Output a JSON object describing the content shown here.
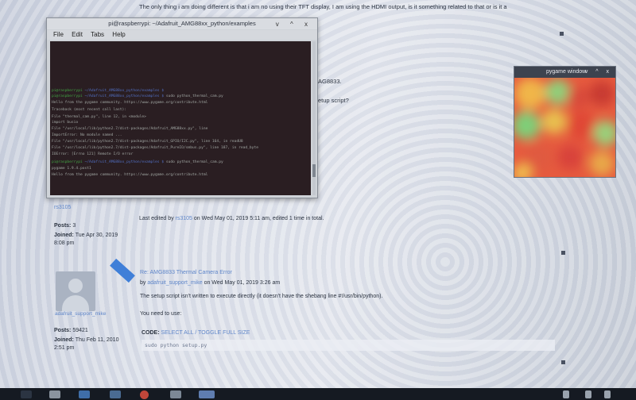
{
  "post_top_text": "The only thing i am doing different is that i am no using their TFT display, I am using the HDMI output, is it something related to that or is it a",
  "terminal": {
    "title": "pi@raspberrypi: ~/Adafruit_AMG88xx_python/examples",
    "menu": [
      "File",
      "Edit",
      "Tabs",
      "Help"
    ],
    "window_controls": "v ^ x",
    "lines": [
      {
        "prompt": "pi@raspberrypi",
        "path": "~/Adafruit_AMG88xx_python/examples $",
        "cmd": ""
      },
      {
        "prompt": "pi@raspberrypi",
        "path": "~/Adafruit_AMG88xx_python/examples $",
        "cmd": "sudo python_thermal_cam.py"
      },
      {
        "text": "Hello from the pygame community. https://www.pygame.org/contribute.html"
      },
      {
        "text": "Traceback (most recent call last):"
      },
      {
        "text": "  File \"thermal_cam.py\", line 12, in <module>"
      },
      {
        "text": "    import busio"
      },
      {
        "text": "  File \"/usr/local/lib/python2.7/dist-packages/Adafruit_AMG88xx.py\", line"
      },
      {
        "text": "ImportError: No module named ..."
      },
      {
        "text": "  File \"/usr/local/lib/python2.7/dist-packages/Adafruit_GPIO/I2C.py\", line 164, in readU8"
      },
      {
        "text": "  File \"/usr/local/lib/python2.7/dist-packages/Adafruit_PureIO/smbus.py\", line 187, in read_byte"
      },
      {
        "text": "IOError: [Errno 121] Remote I/O error"
      },
      {
        "prompt": "pi@raspberrypi",
        "path": "~/Adafruit_AMG88xx_python/examples $",
        "cmd": "sudo python_thermal_cam.py"
      },
      {
        "text": "pygame 1.9.4.post1"
      },
      {
        "text": "Hello from the pygame community. https://www.pygame.org/contribute.html"
      }
    ]
  },
  "pygame_window": {
    "title": "pygame window",
    "controls": "v ^ x"
  },
  "side_fragments": {
    "frag1": "AG8833.",
    "frag2": "etup script?"
  },
  "post1": {
    "author": "rs3105",
    "edit_note_prefix": "Last edited by",
    "edit_note_author": "rs3105",
    "edit_note_suffix": "on Wed May 01, 2019 5:11 am, edited 1 time in total.",
    "posts_label": "Posts:",
    "posts_value": "3",
    "joined_label": "Joined:",
    "joined_value": "Tue Apr 30, 2019",
    "joined_time": "8:08 pm"
  },
  "post2": {
    "title": "Re: AMG8833 Thermal Camera Error",
    "by_prefix": "by",
    "author": "adafruit_support_mike",
    "date": "on Wed May 01, 2019 3:26 am",
    "body1": "The setup script isn't written to execute directly (it doesn't have the shebang line #!/usr/bin/python).",
    "body2": "You need to use:",
    "code_label": "CODE:",
    "code_actions": "SELECT ALL / TOGGLE FULL SIZE",
    "code_text": "sudo python setup.py",
    "posts_label": "Posts:",
    "posts_value": "59421",
    "joined_label": "Joined:",
    "joined_value": "Thu Feb 11, 2010",
    "joined_time": "2:51 pm",
    "author_under_avatar": "adafruit_support_mike"
  },
  "colors": {
    "link": "#5f86c9",
    "taskbar": "#151a22",
    "terminal_bg": "#2a1e22"
  }
}
